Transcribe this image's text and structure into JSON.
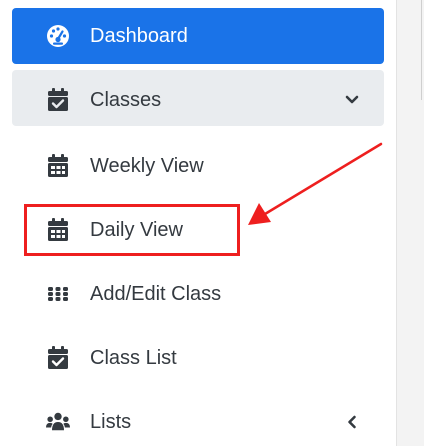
{
  "sidebar": {
    "items": [
      {
        "label": "Dashboard",
        "icon": "dashboard-gauge-icon",
        "active": true
      },
      {
        "label": "Classes",
        "icon": "calendar-check-icon",
        "chevron": "chevron-down-icon",
        "expanded": true
      },
      {
        "label": "Weekly View",
        "icon": "calendar-grid-icon"
      },
      {
        "label": "Daily View",
        "icon": "calendar-grid-icon"
      },
      {
        "label": "Add/Edit Class",
        "icon": "grid-dots-icon"
      },
      {
        "label": "Class List",
        "icon": "calendar-check-icon"
      },
      {
        "label": "Lists",
        "icon": "users-icon",
        "chevron": "chevron-left-icon"
      }
    ]
  },
  "annotation": {
    "color": "#ee1f1f",
    "highlighted_item": "Daily View"
  },
  "colors": {
    "active_bg": "#1a73e8",
    "open_section_bg": "#e9ecef",
    "text": "#343a40"
  }
}
